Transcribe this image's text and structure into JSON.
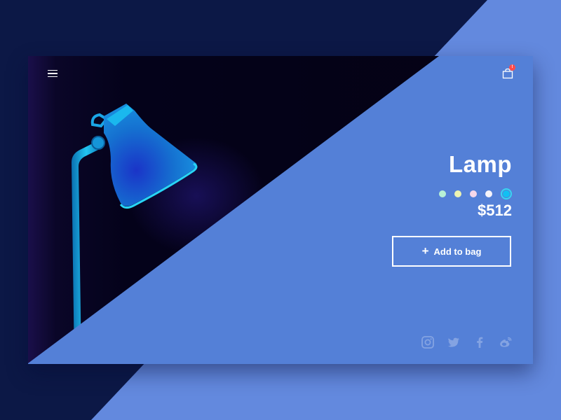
{
  "colors": {
    "page_dark": "#0c1846",
    "page_light": "#6389de",
    "panel": "#5480d7",
    "lamp": "#1ba8e0",
    "badge": "#ff4b4b"
  },
  "header": {
    "menu_icon": "hamburger-menu-icon",
    "cart_icon": "shopping-bag-icon",
    "cart_badge": "!"
  },
  "product": {
    "title": "Lamp",
    "price": "$512",
    "add_button_label": "Add to bag",
    "add_button_icon": "plus-icon",
    "swatches": [
      {
        "color": "#b7f1d6",
        "selected": false
      },
      {
        "color": "#ecf3b2",
        "selected": false
      },
      {
        "color": "#f6d7ea",
        "selected": false
      },
      {
        "color": "#f5f3fa",
        "selected": false
      },
      {
        "color": "#11c0f2",
        "selected": true
      }
    ]
  },
  "social": [
    "instagram-icon",
    "twitter-icon",
    "facebook-icon",
    "weibo-icon"
  ]
}
